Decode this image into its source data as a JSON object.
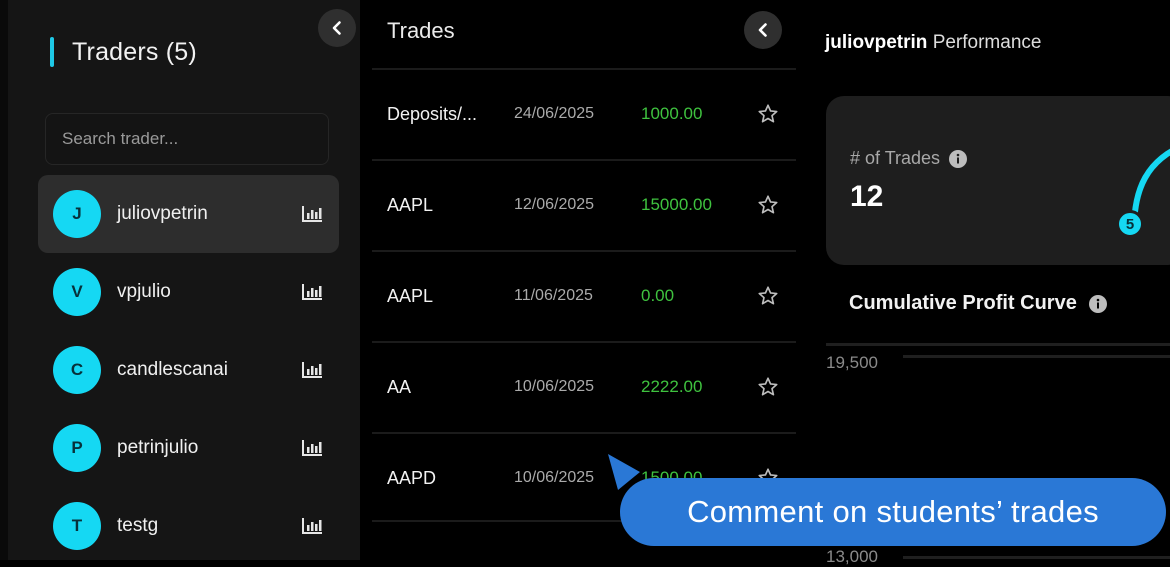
{
  "sidebar": {
    "title": "Traders (5)",
    "collapse_icon": "chevron-left-icon",
    "search": {
      "placeholder": "Search trader..."
    },
    "traders": [
      {
        "initial": "J",
        "name": "juliovpetrin",
        "selected": true
      },
      {
        "initial": "V",
        "name": "vpjulio",
        "selected": false
      },
      {
        "initial": "C",
        "name": "candlescanai",
        "selected": false
      },
      {
        "initial": "P",
        "name": "petrinjulio",
        "selected": false
      },
      {
        "initial": "T",
        "name": "testg",
        "selected": false
      }
    ],
    "accent_color": "#1ec8e6"
  },
  "trades": {
    "title": "Trades",
    "collapse_icon": "chevron-left-icon",
    "rows": [
      {
        "symbol": "Deposits/...",
        "date": "24/06/2025",
        "amount": "1000.00"
      },
      {
        "symbol": "AAPL",
        "date": "12/06/2025",
        "amount": "15000.00"
      },
      {
        "symbol": "AAPL",
        "date": "11/06/2025",
        "amount": "0.00"
      },
      {
        "symbol": "AA",
        "date": "10/06/2025",
        "amount": "2222.00"
      },
      {
        "symbol": "AAPD",
        "date": "10/06/2025",
        "amount": "1500.00"
      }
    ],
    "amount_color": "#3fc23f"
  },
  "performance": {
    "user": "juliovpetrin",
    "title_suffix": "Performance",
    "card": {
      "label": "# of Trades",
      "value": "12",
      "badge": "5"
    },
    "curve_title": "Cumulative Profit Curve",
    "y_ticks": [
      "19,500",
      "13,000"
    ]
  },
  "overlay": {
    "callout_text": "Comment on students’ trades",
    "color": "#2a78d6"
  }
}
